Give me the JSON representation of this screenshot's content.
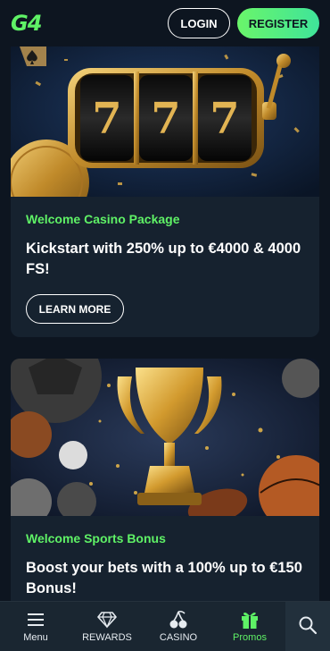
{
  "header": {
    "logo": "G4",
    "login_label": "LOGIN",
    "register_label": "REGISTER"
  },
  "promos": [
    {
      "tag": "Welcome Casino Package",
      "title": "Kickstart with 250% up to €4000 & 4000 FS!",
      "button_label": "LEARN MORE",
      "image": "slot-machine-777"
    },
    {
      "tag": "Welcome Sports Bonus",
      "title": "Boost your bets with a 100% up to €150 Bonus!",
      "image": "golden-trophy-sports-balls"
    }
  ],
  "bottom_nav": {
    "items": [
      {
        "label": "Menu",
        "icon": "menu-icon"
      },
      {
        "label": "REWARDS",
        "icon": "diamond-icon"
      },
      {
        "label": "CASINO",
        "icon": "cherries-icon"
      },
      {
        "label": "Promos",
        "icon": "gift-icon",
        "active": true
      }
    ],
    "search_icon": "search-icon"
  },
  "colors": {
    "accent": "#5ff266",
    "background": "#0d1520",
    "card": "#16222f"
  }
}
